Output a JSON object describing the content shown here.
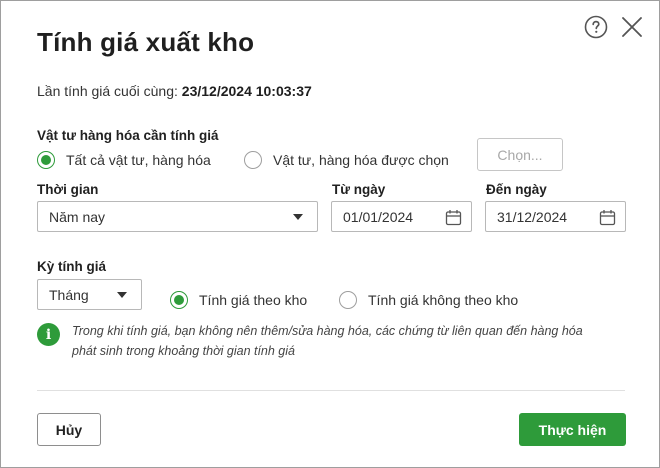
{
  "dialog": {
    "title": "Tính giá xuất kho"
  },
  "last_calc": {
    "label": "Lần tính giá cuối cùng:",
    "value": "23/12/2024 10:03:37"
  },
  "materials": {
    "label": "Vật tư hàng hóa cần tính giá",
    "option_all": "Tất cả vật tư, hàng hóa",
    "option_selected": "Vật tư, hàng hóa được chọn",
    "selected": "all",
    "choose_button": "Chọn..."
  },
  "period": {
    "time_label": "Thời gian",
    "time_value": "Năm nay",
    "from_label": "Từ ngày",
    "from_value": "01/01/2024",
    "to_label": "Đến ngày",
    "to_value": "31/12/2024"
  },
  "pricing_period": {
    "label": "Kỳ tính giá",
    "value": "Tháng",
    "option_by_warehouse": "Tính giá theo kho",
    "option_not_by_warehouse": "Tính giá không theo kho",
    "selected": "by_warehouse"
  },
  "info": {
    "line1": "Trong khi tính giá, bạn không nên thêm/sửa hàng hóa, các chứng từ liên quan đến hàng hóa",
    "line2": "phát sinh trong khoảng thời gian tính giá"
  },
  "footer": {
    "cancel": "Hủy",
    "execute": "Thực hiện"
  },
  "colors": {
    "accent": "#2e9b3a",
    "disabled_text": "#a8a8a8"
  },
  "icons": {
    "help": "help-icon",
    "close": "close-icon",
    "calendar": "calendar-icon",
    "info": "info-icon"
  }
}
